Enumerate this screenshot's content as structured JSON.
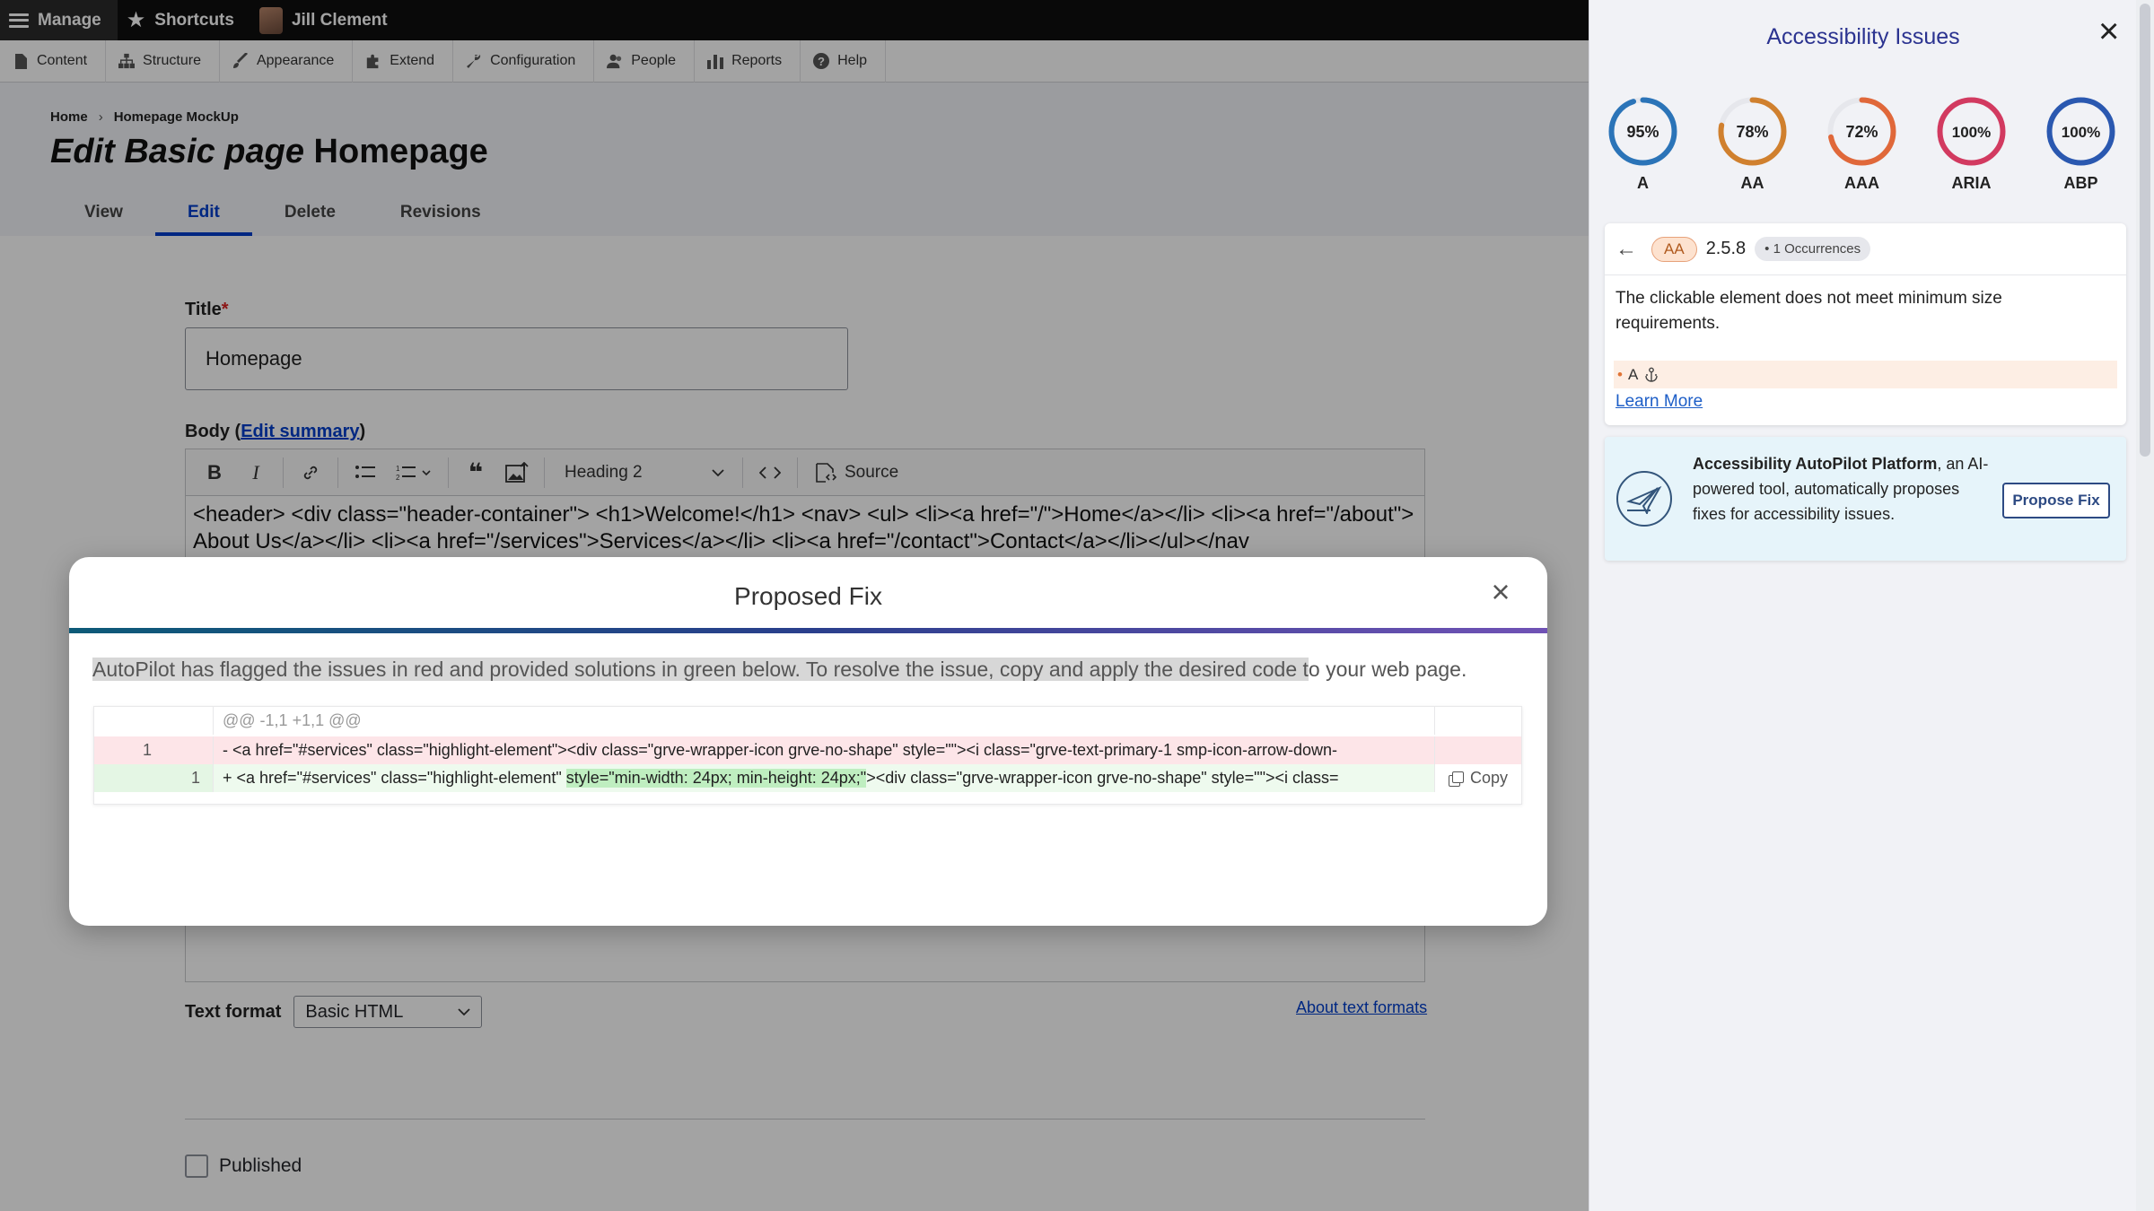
{
  "admin_bar": {
    "manage": "Manage",
    "shortcuts": "Shortcuts",
    "user": "Jill Clement"
  },
  "toolbar": {
    "items": [
      "Content",
      "Structure",
      "Appearance",
      "Extend",
      "Configuration",
      "People",
      "Reports",
      "Help"
    ]
  },
  "breadcrumb": [
    "Home",
    "Homepage MockUp"
  ],
  "page_title": {
    "prefix": "Edit Basic page",
    "name": "Homepage"
  },
  "tabs": [
    "View",
    "Edit",
    "Delete",
    "Revisions"
  ],
  "active_tab": "Edit",
  "form": {
    "title_label": "Title",
    "title_required": "*",
    "title_value": "Homepage",
    "body_label": "Body (",
    "body_link": "Edit summary",
    "body_label_end": ")",
    "heading_select": "Heading 2",
    "source_label": "Source",
    "body_content": "<header> <div class=\"header-container\"> <h1>Welcome!</h1> <nav> <ul> <li><a href=\"/\">Home</a></li> <li><a href=\"/about\">About Us</a></li> <li><a href=\"/services\">Services</a></li> <li><a href=\"/contact\">Contact</a></li></ul></nav",
    "text_format_label": "Text format",
    "text_format_value": "Basic HTML",
    "about_text_formats": "About text formats",
    "published_label": "Published"
  },
  "modal": {
    "title": "Proposed Fix",
    "desc_highlight": "AutoPilot has flagged the issues in red and provided solutions in green below. To resolve the issue, copy and apply the desired code t",
    "desc_rest": "o your web page.",
    "hunk": "@@ -1,1 +1,1 @@",
    "del_line_no": "1",
    "del_code": "- <a href=\"#services\" class=\"highlight-element\"><div class=\"grve-wrapper-icon grve-no-shape\" style=\"\"><i class=\"grve-text-primary-1 smp-icon-arrow-down-",
    "add_line_no": "1",
    "add_code_pre": "+ <a href=\"#services\" class=\"highlight-element\" ",
    "add_code_ins": "style=\"min-width: 24px; min-height: 24px;\"",
    "add_code_post": "><div class=\"grve-wrapper-icon grve-no-shape\" style=\"\"><i class=",
    "copy_label": "Copy"
  },
  "panel": {
    "title": "Accessibility Issues",
    "gauges": [
      {
        "value": 95,
        "text": "95%",
        "label": "A",
        "color": "#2b74b8"
      },
      {
        "value": 78,
        "text": "78%",
        "label": "AA",
        "color": "#d0802e"
      },
      {
        "value": 72,
        "text": "72%",
        "label": "AAA",
        "color": "#e0683a"
      },
      {
        "value": 100,
        "text": "100%",
        "label": "ARIA",
        "color": "#d23a60"
      },
      {
        "value": 100,
        "text": "100%",
        "label": "ABP",
        "color": "#2a58b0"
      }
    ],
    "issue": {
      "level": "AA",
      "criterion": "2.5.8",
      "occurrences": "• 1 Occurrences",
      "description": "The clickable element does not meet minimum size requirements.",
      "element_label": "A",
      "learn_more": "Learn More"
    },
    "promo": {
      "brand": "Accessibility AutoPilot Platform",
      "text": ", an AI-powered tool, automatically proposes fixes for accessibility issues.",
      "button": "Propose Fix"
    }
  }
}
